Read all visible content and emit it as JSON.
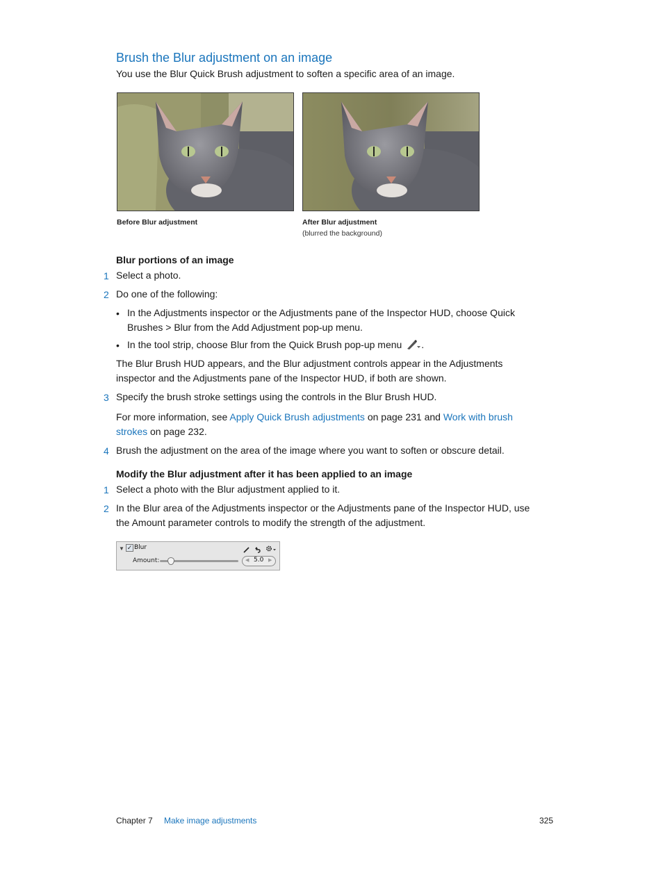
{
  "section": {
    "title": "Brush the Blur adjustment on an image",
    "intro": "You use the Blur Quick Brush adjustment to soften a specific area of an image."
  },
  "figures": [
    {
      "caption": "Before Blur adjustment",
      "subcaption": ""
    },
    {
      "caption": "After Blur adjustment",
      "subcaption": "(blurred the background)"
    }
  ],
  "task1": {
    "heading": "Blur portions of an image",
    "step1_num": "1",
    "step1": "Select a photo.",
    "step2_num": "2",
    "step2": "Do one of the following:",
    "bullet_char": "•",
    "bullet1_line1": "In the Adjustments inspector or the Adjustments pane of the Inspector HUD, choose Quick",
    "bullet1_line2": "Brushes > Blur from the Add Adjustment pop-up menu.",
    "bullet2": "In the tool strip, choose Blur from the Quick Brush pop-up menu",
    "bullet2_end": ".",
    "bullet2_icon": "quick-brush-popup-icon",
    "para_line1": "The Blur Brush HUD appears, and the Blur adjustment controls appear in the Adjustments",
    "para_line2": "inspector and the Adjustments pane of the Inspector HUD, if both are shown.",
    "step3_num": "3",
    "step3": "Specify the brush stroke settings using the controls in the Blur Brush HUD.",
    "more_prefix": "For more information, see ",
    "more_link1": "Apply Quick Brush adjustments",
    "more_mid": " on page 231 and ",
    "more_link2a": "Work with brush",
    "more_link2b": "strokes",
    "more_suffix": " on page 232.",
    "step4_num": "4",
    "step4": "Brush the adjustment on the area of the image where you want to soften or obscure detail."
  },
  "task2": {
    "heading": "Modify the Blur adjustment after it has been applied to an image",
    "step1_num": "1",
    "step1": "Select a photo with the Blur adjustment applied to it.",
    "step2_num": "2",
    "step2_line1": "In the Blur area of the Adjustments inspector or the Adjustments pane of the Inspector HUD, use",
    "step2_line2": "the Amount parameter controls to modify the strength of the adjustment."
  },
  "blur_panel": {
    "title": "Blur",
    "checked": true,
    "amount_label": "Amount:",
    "amount_value": "5.0",
    "slider_fraction": 0.1
  },
  "footer": {
    "chapter": "Chapter 7",
    "chapter_title": "Make image adjustments",
    "page": "325"
  },
  "colors": {
    "accent": "#1a75bc",
    "text": "#1a1a1a"
  }
}
